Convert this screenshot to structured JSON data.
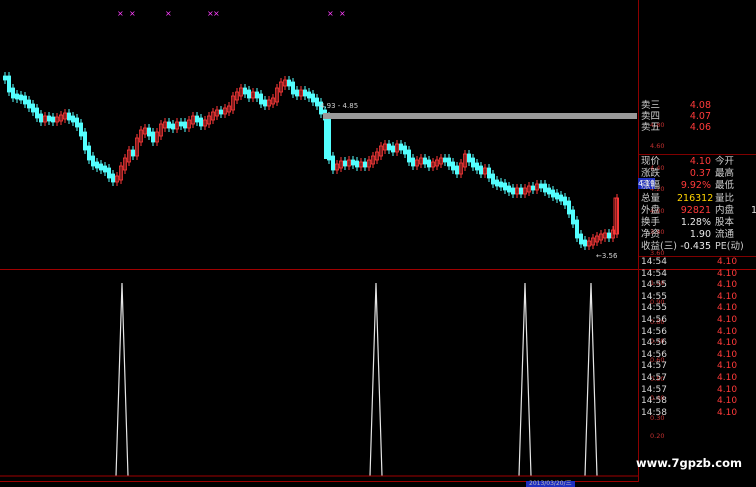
{
  "main_chart": {
    "range_label": "4.93 - 4.85",
    "low_label": "3.56",
    "current_price_tag": "4.19",
    "axis_ticks": [
      "4.80",
      "4.60",
      "4.40",
      "4.20",
      "4.00",
      "3.80",
      "3.60"
    ],
    "marker_glyph": "×"
  },
  "indicator_chart": {
    "axis_ticks": [
      "1.00",
      "0.90",
      "0.80",
      "0.70",
      "0.60",
      "0.50",
      "0.40",
      "0.30",
      "0.20",
      "0.10",
      "0.00"
    ],
    "date_label": "2013/03/20/三"
  },
  "order_book": [
    {
      "label": "卖三",
      "price": "4.08"
    },
    {
      "label": "卖四",
      "price": "4.07"
    },
    {
      "label": "卖五",
      "price": "4.06"
    }
  ],
  "quote": [
    {
      "label": "现价",
      "value": "4.10",
      "value_color": "red",
      "label2": "今开",
      "value2": ""
    },
    {
      "label": "涨跌",
      "value": "0.37",
      "value_color": "red",
      "label2": "最高",
      "value2": ""
    },
    {
      "label": "涨幅",
      "value": "9.92%",
      "value_color": "red",
      "label2": "最低",
      "value2": ""
    },
    {
      "label": "总量",
      "value": "216312",
      "value_color": "yel",
      "label2": "量比",
      "value2": ""
    },
    {
      "label": "外盘",
      "value": "92821",
      "value_color": "red",
      "label2": "内盘",
      "value2": "1"
    },
    {
      "label": "换手",
      "value": "1.28%",
      "value_color": "wht",
      "label2": "股本",
      "value2": ""
    },
    {
      "label": "净资",
      "value": "1.90",
      "value_color": "wht",
      "label2": "流通",
      "value2": ""
    },
    {
      "label": "收益(三)",
      "value": "-0.435",
      "value_color": "wht",
      "label2": "PE(动)",
      "value2": ""
    }
  ],
  "ticks": [
    {
      "time": "14:54",
      "price": "4.10"
    },
    {
      "time": "14:54",
      "price": "4.10"
    },
    {
      "time": "14:55",
      "price": "4.10"
    },
    {
      "time": "14:55",
      "price": "4.10"
    },
    {
      "time": "14:55",
      "price": "4.10"
    },
    {
      "time": "14:56",
      "price": "4.10"
    },
    {
      "time": "14:56",
      "price": "4.10"
    },
    {
      "time": "14:56",
      "price": "4.10"
    },
    {
      "time": "14:56",
      "price": "4.10"
    },
    {
      "time": "14:57",
      "price": "4.10"
    },
    {
      "time": "14:57",
      "price": "4.10"
    },
    {
      "time": "14:57",
      "price": "4.10"
    },
    {
      "time": "14:58",
      "price": "4.10"
    },
    {
      "time": "14:58",
      "price": "4.10"
    }
  ],
  "watermark": "www.7gpzb.com",
  "colors": {
    "up": "#ff3a3a",
    "down": "#54ffff",
    "bg": "#000000",
    "grid": "#a00000",
    "accent": "#1d2ec0"
  }
}
